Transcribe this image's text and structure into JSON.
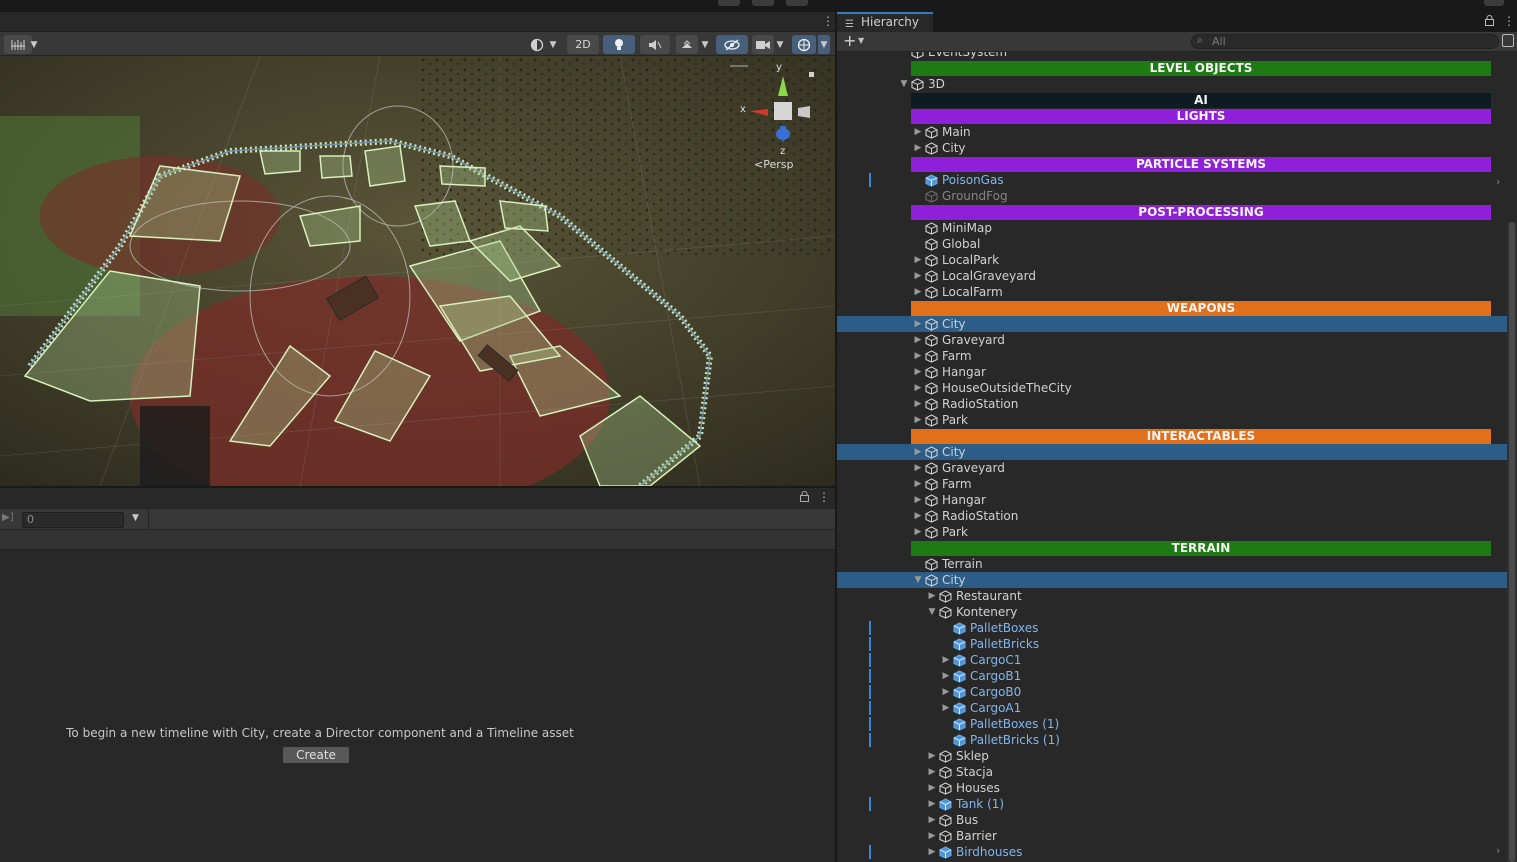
{
  "scene_toolbar": {
    "mode_2d_label": "2D"
  },
  "gizmo": {
    "x_label": "x",
    "y_label": "y",
    "z_label": "z",
    "projection_label": "Persp"
  },
  "timeline": {
    "frame_value": "0",
    "message": "To begin a new timeline with City, create a Director component and a Timeline asset",
    "create_label": "Create"
  },
  "hierarchy": {
    "tab_title": "Hierarchy",
    "search_placeholder": "All",
    "rows": [
      {
        "label": "EventSystem",
        "indent": 0,
        "arrow": "",
        "cube": true,
        "kind": "normal"
      },
      {
        "label": "LEVEL OBJECTS",
        "kind": "header",
        "color": "#1e7a12"
      },
      {
        "label": "3D",
        "indent": 0,
        "arrow": "open",
        "cube": true,
        "kind": "normal"
      },
      {
        "label": "AI",
        "kind": "header",
        "color": "#0c1c22"
      },
      {
        "label": "LIGHTS",
        "kind": "header",
        "color": "#8f1fd8"
      },
      {
        "label": "Main",
        "indent": 1,
        "arrow": "closed",
        "cube": true,
        "kind": "normal"
      },
      {
        "label": "City",
        "indent": 1,
        "arrow": "closed",
        "cube": true,
        "kind": "normal"
      },
      {
        "label": "PARTICLE SYSTEMS",
        "kind": "header",
        "color": "#8f1fd8"
      },
      {
        "label": "PoisonGas",
        "indent": 1,
        "arrow": "",
        "cube": true,
        "kind": "prefab",
        "marker": true
      },
      {
        "label": "GroundFog",
        "indent": 1,
        "arrow": "",
        "cube": true,
        "kind": "disabled"
      },
      {
        "label": "POST-PROCESSING",
        "kind": "header",
        "color": "#8f1fd8"
      },
      {
        "label": "MiniMap",
        "indent": 1,
        "arrow": "",
        "cube": true,
        "kind": "normal"
      },
      {
        "label": "Global",
        "indent": 1,
        "arrow": "",
        "cube": true,
        "kind": "normal"
      },
      {
        "label": "LocalPark",
        "indent": 1,
        "arrow": "closed",
        "cube": true,
        "kind": "normal"
      },
      {
        "label": "LocalGraveyard",
        "indent": 1,
        "arrow": "closed",
        "cube": true,
        "kind": "normal"
      },
      {
        "label": "LocalFarm",
        "indent": 1,
        "arrow": "closed",
        "cube": true,
        "kind": "normal"
      },
      {
        "label": "WEAPONS",
        "kind": "header",
        "color": "#e2701b"
      },
      {
        "label": "City",
        "indent": 1,
        "arrow": "closed",
        "cube": true,
        "kind": "normal",
        "selected": true
      },
      {
        "label": "Graveyard",
        "indent": 1,
        "arrow": "closed",
        "cube": true,
        "kind": "normal"
      },
      {
        "label": "Farm",
        "indent": 1,
        "arrow": "closed",
        "cube": true,
        "kind": "normal"
      },
      {
        "label": "Hangar",
        "indent": 1,
        "arrow": "closed",
        "cube": true,
        "kind": "normal"
      },
      {
        "label": "HouseOutsideTheCity",
        "indent": 1,
        "arrow": "closed",
        "cube": true,
        "kind": "normal"
      },
      {
        "label": "RadioStation",
        "indent": 1,
        "arrow": "closed",
        "cube": true,
        "kind": "normal"
      },
      {
        "label": "Park",
        "indent": 1,
        "arrow": "closed",
        "cube": true,
        "kind": "normal"
      },
      {
        "label": "INTERACTABLES",
        "kind": "header",
        "color": "#e2701b"
      },
      {
        "label": "City",
        "indent": 1,
        "arrow": "closed",
        "cube": true,
        "kind": "normal",
        "selected": true
      },
      {
        "label": "Graveyard",
        "indent": 1,
        "arrow": "closed",
        "cube": true,
        "kind": "normal"
      },
      {
        "label": "Farm",
        "indent": 1,
        "arrow": "closed",
        "cube": true,
        "kind": "normal"
      },
      {
        "label": "Hangar",
        "indent": 1,
        "arrow": "closed",
        "cube": true,
        "kind": "normal"
      },
      {
        "label": "RadioStation",
        "indent": 1,
        "arrow": "closed",
        "cube": true,
        "kind": "normal"
      },
      {
        "label": "Park",
        "indent": 1,
        "arrow": "closed",
        "cube": true,
        "kind": "normal"
      },
      {
        "label": "TERRAIN",
        "kind": "header",
        "color": "#1e7a12"
      },
      {
        "label": "Terrain",
        "indent": 1,
        "arrow": "",
        "cube": true,
        "kind": "normal"
      },
      {
        "label": "City",
        "indent": 1,
        "arrow": "open",
        "cube": true,
        "kind": "normal",
        "selected": true
      },
      {
        "label": "Restaurant",
        "indent": 2,
        "arrow": "closed",
        "cube": true,
        "kind": "normal"
      },
      {
        "label": "Kontenery",
        "indent": 2,
        "arrow": "open",
        "cube": true,
        "kind": "normal"
      },
      {
        "label": "PalletBoxes",
        "indent": 3,
        "arrow": "",
        "cube": true,
        "kind": "prefab",
        "marker": true
      },
      {
        "label": "PalletBricks",
        "indent": 3,
        "arrow": "",
        "cube": true,
        "kind": "prefab",
        "marker": true
      },
      {
        "label": "CargoC1",
        "indent": 3,
        "arrow": "closed",
        "cube": true,
        "kind": "prefab",
        "marker": true
      },
      {
        "label": "CargoB1",
        "indent": 3,
        "arrow": "closed",
        "cube": true,
        "kind": "prefab",
        "marker": true
      },
      {
        "label": "CargoB0",
        "indent": 3,
        "arrow": "closed",
        "cube": true,
        "kind": "prefab",
        "marker": true
      },
      {
        "label": "CargoA1",
        "indent": 3,
        "arrow": "closed",
        "cube": true,
        "kind": "prefab",
        "marker": true
      },
      {
        "label": "PalletBoxes (1)",
        "indent": 3,
        "arrow": "",
        "cube": true,
        "kind": "prefab",
        "marker": true
      },
      {
        "label": "PalletBricks (1)",
        "indent": 3,
        "arrow": "",
        "cube": true,
        "kind": "prefab",
        "marker": true
      },
      {
        "label": "Sklep",
        "indent": 2,
        "arrow": "closed",
        "cube": true,
        "kind": "normal"
      },
      {
        "label": "Stacja",
        "indent": 2,
        "arrow": "closed",
        "cube": true,
        "kind": "normal"
      },
      {
        "label": "Houses",
        "indent": 2,
        "arrow": "closed",
        "cube": true,
        "kind": "normal"
      },
      {
        "label": "Tank (1)",
        "indent": 2,
        "arrow": "closed",
        "cube": true,
        "kind": "prefab",
        "marker": true
      },
      {
        "label": "Bus",
        "indent": 2,
        "arrow": "closed",
        "cube": true,
        "kind": "normal"
      },
      {
        "label": "Barrier",
        "indent": 2,
        "arrow": "closed",
        "cube": true,
        "kind": "normal"
      },
      {
        "label": "Birdhouses",
        "indent": 2,
        "arrow": "closed",
        "cube": true,
        "kind": "prefab",
        "marker": true
      }
    ]
  },
  "colors": {
    "selection": "#2c5d87",
    "prefab_text": "#7fb6ef",
    "accent": "#3a79bb"
  }
}
